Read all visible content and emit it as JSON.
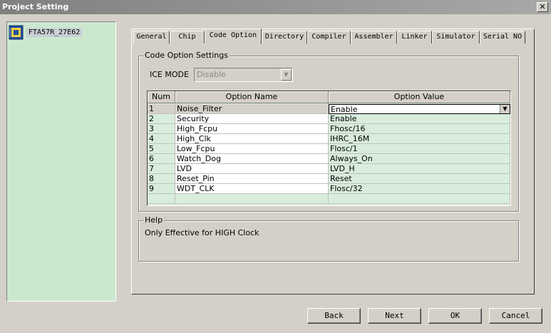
{
  "window": {
    "title": "Project Setting",
    "close_label": "✕"
  },
  "tree": {
    "item_label": "FTA57R_27E62"
  },
  "tabs": [
    {
      "label": "General"
    },
    {
      "label": "Chip"
    },
    {
      "label": "Code Option"
    },
    {
      "label": "Directory"
    },
    {
      "label": "Compiler"
    },
    {
      "label": "Assembler"
    },
    {
      "label": "Linker"
    },
    {
      "label": "Simulator"
    },
    {
      "label": "Serial NO"
    }
  ],
  "active_tab": "Code Option",
  "code_option": {
    "group_title": "Code Option Settings",
    "ice_mode_label": "ICE MODE",
    "ice_mode_value": "Disable"
  },
  "grid": {
    "headers": {
      "num": "Num",
      "name": "Option Name",
      "value": "Option Value"
    },
    "rows": [
      {
        "num": "1",
        "name": "Noise_Filter",
        "value": "Enable"
      },
      {
        "num": "2",
        "name": "Security",
        "value": "Enable"
      },
      {
        "num": "3",
        "name": "High_Fcpu",
        "value": "Fhosc/16"
      },
      {
        "num": "4",
        "name": "High_Clk",
        "value": "IHRC_16M"
      },
      {
        "num": "5",
        "name": "Low_Fcpu",
        "value": "Flosc/1"
      },
      {
        "num": "6",
        "name": "Watch_Dog",
        "value": "Always_On"
      },
      {
        "num": "7",
        "name": "LVD",
        "value": "LVD_H"
      },
      {
        "num": "8",
        "name": "Reset_Pin",
        "value": "Reset"
      },
      {
        "num": "9",
        "name": "WDT_CLK",
        "value": "Flosc/32"
      }
    ]
  },
  "help": {
    "group_title": "Help",
    "text": "Only Effective for HIGH Clock"
  },
  "buttons": {
    "back": "Back",
    "next": "Next",
    "ok": "OK",
    "cancel": "Cancel"
  },
  "colors": {
    "panel_green": "#cbe8cf",
    "grid_green": "#d8eddc",
    "title_gray": "#808080"
  }
}
